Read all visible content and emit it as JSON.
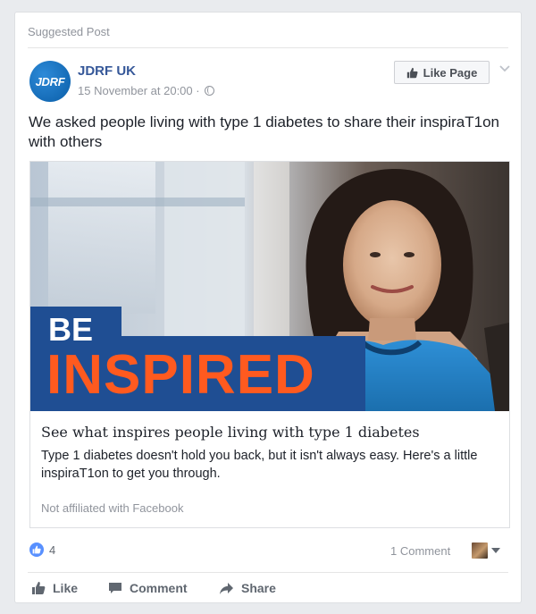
{
  "post": {
    "suggested_label": "Suggested Post",
    "page_name": "JDRF UK",
    "avatar_text": "JDRF",
    "timestamp": "15 November at 20:00 ·",
    "like_page_label": "Like Page",
    "text": "We asked people living with type 1 diabetes to share their inspiraT1on with others"
  },
  "link_preview": {
    "image_headline_line1": "BE",
    "image_headline_line2": "INSPIRED",
    "title": "See what inspires people living with type 1 diabetes",
    "description": "Type 1 diabetes doesn't hold you back, but it isn't always easy. Here's a little inspiraT1on to get you through.",
    "domain_text": "Not affiliated with Facebook"
  },
  "engagement": {
    "like_count": "4",
    "comments_label": "1 Comment"
  },
  "actions": {
    "like_label": "Like",
    "comment_label": "Comment",
    "share_label": "Share"
  },
  "colors": {
    "page_background": "#e9ebee",
    "link_blue": "#365899",
    "brand_blue": "#1f5aa6",
    "inspired_orange": "#ff5a1f",
    "reaction_blue": "#5890ff"
  },
  "icons": {
    "avatar": "jdrf-logo",
    "privacy": "globe-icon",
    "like_page": "thumbs-up-icon",
    "menu": "chevron-down-icon",
    "reaction": "like-reaction-icon",
    "like": "thumbs-up-icon",
    "comment": "comment-bubble-icon",
    "share": "share-arrow-icon"
  }
}
